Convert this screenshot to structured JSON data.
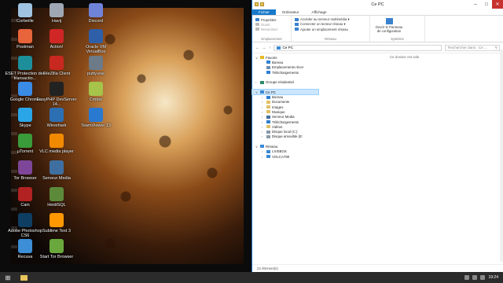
{
  "desktop": {
    "icons": [
      {
        "label": "Corbeille",
        "icon": "recycle-bin-icon",
        "color": "#9fc3e0"
      },
      {
        "label": "Havij",
        "icon": "havij-icon",
        "color": "#9ea7b3"
      },
      {
        "label": "Discord",
        "icon": "discord-icon",
        "color": "#6f83d8"
      },
      {
        "label": "Postman",
        "icon": "postman-icon",
        "color": "#e8643a"
      },
      {
        "label": "Action!",
        "icon": "action-icon",
        "color": "#d02626"
      },
      {
        "label": "Oracle VM VirtualBox",
        "icon": "virtualbox-icon",
        "color": "#2f5fa8"
      },
      {
        "label": "ESET Protection des transactio...",
        "icon": "eset-icon",
        "color": "#1c8f9a"
      },
      {
        "label": "FileZilla Client",
        "icon": "filezilla-icon",
        "color": "#c8281f"
      },
      {
        "label": "putty.exe",
        "icon": "putty-icon",
        "color": "#6d7a88"
      },
      {
        "label": "Google Chrome",
        "icon": "chrome-icon",
        "color": "#3a8be5"
      },
      {
        "label": "EasyPHP DevServer 14...",
        "icon": "easyphp-icon",
        "color": "#222222"
      },
      {
        "label": "Cmder",
        "icon": "cmder-icon",
        "color": "#a6c34a"
      },
      {
        "label": "Skype",
        "icon": "skype-icon",
        "color": "#2aa6e8"
      },
      {
        "label": "Wireshark",
        "icon": "wireshark-icon",
        "color": "#2d6fb3"
      },
      {
        "label": "TeamViewer 13",
        "icon": "teamviewer-icon",
        "color": "#2a79d1"
      },
      {
        "label": "µTorrent",
        "icon": "utorrent-icon",
        "color": "#3a9b3a"
      },
      {
        "label": "VLC media player",
        "icon": "vlc-icon",
        "color": "#f28a00"
      },
      {
        "label": "Tor Browser",
        "icon": "tor-icon",
        "color": "#7d4698"
      },
      {
        "label": "Serveur Media",
        "icon": "media-server-icon",
        "color": "#3f6fa0"
      },
      {
        "label": "Cain",
        "icon": "cain-icon",
        "color": "#b22222"
      },
      {
        "label": "HeidiSQL",
        "icon": "heidisql-icon",
        "color": "#5c8a3a"
      },
      {
        "label": "Adobe Photoshop CS6",
        "icon": "photoshop-icon",
        "color": "#0f3e63"
      },
      {
        "label": "Sublime Text 3",
        "icon": "sublime-icon",
        "color": "#ff9800"
      },
      {
        "label": "Recuva",
        "icon": "recuva-icon",
        "color": "#3c8ed6"
      },
      {
        "label": "Start Tor Browser",
        "icon": "start-tor-icon",
        "color": "#6aa83d"
      }
    ]
  },
  "explorer": {
    "title": "Ce PC",
    "tabs": [
      "Fichier",
      "Ordinateur",
      "Affichage"
    ],
    "ribbon": {
      "groups": [
        {
          "label": "Emplacement",
          "items": [
            "Propriétés",
            "Ouvrir",
            "Renommer"
          ]
        },
        {
          "label": "Réseau",
          "items": [
            "Accéder au serveur multimédia ▾",
            "Connecter un lecteur réseau ▾",
            "Ajouter un emplacement réseau"
          ]
        },
        {
          "label": "Système",
          "big": "Ouvrir le Panneau de configuration"
        }
      ]
    },
    "address": "Ce PC",
    "search_placeholder": "Rechercher dans : Ce ...",
    "empty_message": "Ce dossier est vide.",
    "tree": [
      {
        "label": "Favoris",
        "level": 0,
        "exp": "∨",
        "icon": "star-icon",
        "color": "#e8b923"
      },
      {
        "label": "Bureau",
        "level": 1,
        "icon": "desktop-folder-icon",
        "color": "#2f7fd1"
      },
      {
        "label": "Emplacements récer",
        "level": 1,
        "icon": "recent-places-icon",
        "color": "#6a8fb0"
      },
      {
        "label": "Téléchargements",
        "level": 1,
        "icon": "downloads-icon",
        "color": "#2f7fd1"
      },
      {
        "label": "",
        "level": 0,
        "spacer": true
      },
      {
        "label": "Groupe résidentiel",
        "level": 0,
        "exp": "›",
        "icon": "homegroup-icon",
        "color": "#2a8a6a"
      },
      {
        "label": "",
        "level": 0,
        "spacer": true
      },
      {
        "label": "Ce PC",
        "level": 0,
        "exp": "∨",
        "icon": "computer-icon",
        "color": "#3a8ad8",
        "selected": true
      },
      {
        "label": "Bureau",
        "level": 1,
        "exp": "›",
        "icon": "desktop-folder-icon",
        "color": "#2f7fd1"
      },
      {
        "label": "Documents",
        "level": 1,
        "exp": "›",
        "icon": "documents-icon",
        "color": "#e0c068"
      },
      {
        "label": "Images",
        "level": 1,
        "exp": "›",
        "icon": "images-icon",
        "color": "#e0c068"
      },
      {
        "label": "Musique",
        "level": 1,
        "exp": "›",
        "icon": "music-icon",
        "color": "#e0c068"
      },
      {
        "label": "Serveur Media",
        "level": 1,
        "exp": "›",
        "icon": "media-server-icon",
        "color": "#3f6fa0"
      },
      {
        "label": "Téléchargements",
        "level": 1,
        "exp": "›",
        "icon": "downloads-icon",
        "color": "#2f7fd1"
      },
      {
        "label": "Vidéos",
        "level": 1,
        "exp": "›",
        "icon": "videos-icon",
        "color": "#e0c068"
      },
      {
        "label": "Disque local (C:)",
        "level": 1,
        "exp": "›",
        "icon": "local-disk-icon",
        "color": "#8a9aa8"
      },
      {
        "label": "Disque amovible (E:",
        "level": 1,
        "exp": "›",
        "icon": "removable-disk-icon",
        "color": "#8a9aa8"
      },
      {
        "label": "",
        "level": 0,
        "spacer": true
      },
      {
        "label": "Réseau",
        "level": 0,
        "exp": "∨",
        "icon": "network-icon",
        "color": "#3a8ad8"
      },
      {
        "label": "LIVEBOX",
        "level": 1,
        "exp": "›",
        "icon": "network-computer-icon",
        "color": "#3a8ad8"
      },
      {
        "label": "VOLCA780",
        "level": 1,
        "exp": "›",
        "icon": "network-computer-icon",
        "color": "#3a8ad8"
      }
    ],
    "status": "22 élément(s)"
  },
  "taskbar": {
    "clock": "19:24",
    "start_icon": "⊞"
  }
}
